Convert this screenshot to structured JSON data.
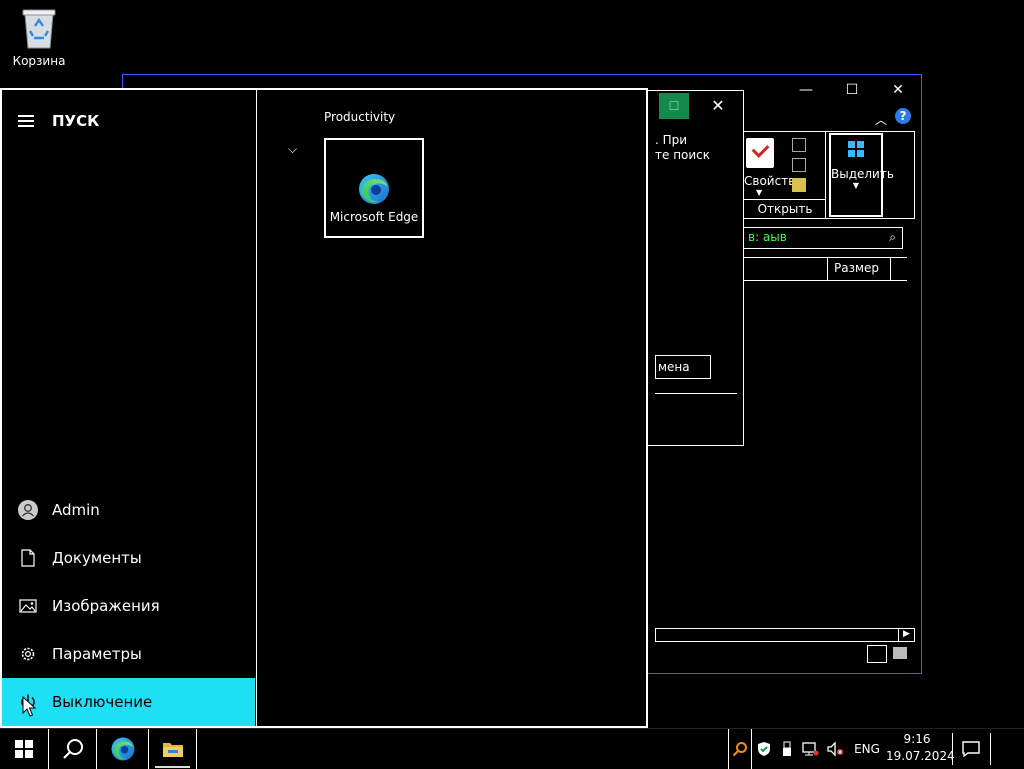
{
  "desktop": {
    "recycle_bin_label": "Корзина"
  },
  "explorer": {
    "minimize": "—",
    "maximize": "☐",
    "close": "✕",
    "ribbon_properties": "Свойства",
    "ribbon_group_open": "Открыть",
    "ribbon_select": "Выделить",
    "search_text": "в: аыв",
    "col_size": "Размер"
  },
  "dialog": {
    "text_line1": ". При",
    "text_line2": "те поиск",
    "cancel_label": "мена",
    "close": "✕"
  },
  "start_menu": {
    "title": "ПУСК",
    "group_title": "Productivity",
    "tile_label": "Microsoft Edge",
    "items": [
      {
        "label": "Admin",
        "icon": "user-icon"
      },
      {
        "label": "Документы",
        "icon": "document-icon"
      },
      {
        "label": "Изображения",
        "icon": "pictures-icon"
      },
      {
        "label": "Параметры",
        "icon": "gear-icon"
      },
      {
        "label": "Выключение",
        "icon": "power-icon"
      }
    ]
  },
  "taskbar": {
    "language": "ENG",
    "time": "9:16",
    "date": "19.07.2024"
  },
  "colors": {
    "accent": "#1ee0f5",
    "explorer_border": "#3a5cff"
  }
}
